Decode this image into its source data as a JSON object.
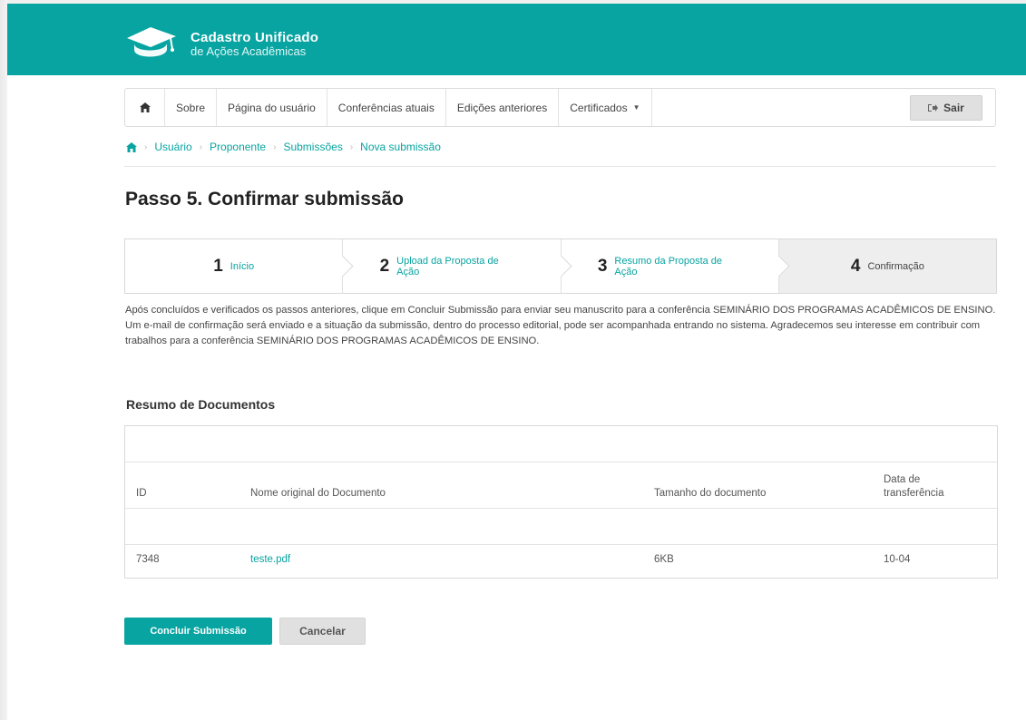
{
  "header": {
    "title": "Cadastro Unificado",
    "subtitle": "de Ações Acadêmicas",
    "logo_icon": "graduation-cap-icon",
    "brand_color": "#07a4a1"
  },
  "nav": {
    "home_icon": "home-icon",
    "items": [
      "Sobre",
      "Página do usuário",
      "Conferências atuais",
      "Edições anteriores",
      "Certificados"
    ],
    "logout_label": "Sair",
    "logout_icon": "sign-out-icon"
  },
  "breadcrumb": {
    "home_icon": "home-icon",
    "items": [
      "Usuário",
      "Proponente",
      "Submissões",
      "Nova submissão"
    ]
  },
  "page": {
    "title": "Passo 5. Confirmar submissão"
  },
  "steps": [
    {
      "number": "1",
      "label": "Início"
    },
    {
      "number": "2",
      "label": "Upload da Proposta de Ação"
    },
    {
      "number": "3",
      "label": "Resumo da Proposta de Ação"
    },
    {
      "number": "4",
      "label": "Confirmação"
    }
  ],
  "intro": "Após concluídos e verificados os passos anteriores, clique em Concluir Submissão para enviar seu manuscrito para a conferência SEMINÁRIO DOS PROGRAMAS ACADÊMICOS DE ENSINO. Um e-mail de confirmação será enviado e a situação da submissão, dentro do processo editorial, pode ser acompanhada entrando no sistema. Agradecemos seu interesse em contribuir com trabalhos para a conferência SEMINÁRIO DOS PROGRAMAS ACADÊMICOS DE ENSINO.",
  "documents": {
    "title": "Resumo de Documentos",
    "headers": {
      "id": "ID",
      "name": "Nome original do Documento",
      "size": "Tamanho do documento",
      "date_line1": "Data de",
      "date_line2": "transferência"
    },
    "rows": [
      {
        "id": "7348",
        "name": "teste.pdf",
        "size": "6KB",
        "date": "10-04"
      }
    ]
  },
  "actions": {
    "submit_label": "Concluir Submissão",
    "cancel_label": "Cancelar"
  }
}
